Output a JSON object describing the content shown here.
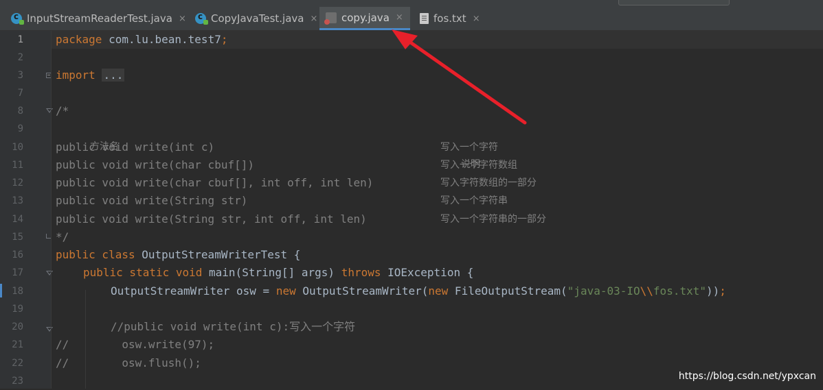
{
  "tabs": [
    {
      "label": "InputStreamReaderTest.java",
      "icon": "java-class-icon",
      "active": false
    },
    {
      "label": "CopyJavaTest.java",
      "icon": "java-class-icon",
      "active": false
    },
    {
      "label": "copy.java",
      "icon": "java-file-icon",
      "active": true
    },
    {
      "label": "fos.txt",
      "icon": "text-file-icon",
      "active": false
    }
  ],
  "close_glyph": "×",
  "line_numbers": [
    "1",
    "2",
    "3",
    "7",
    "8",
    "9",
    "10",
    "11",
    "12",
    "13",
    "14",
    "15",
    "16",
    "17",
    "18",
    "19",
    "20",
    "21",
    "22",
    "23"
  ],
  "code": {
    "l1_kw": "package",
    "l1_rest": " com.lu.bean.test7",
    "l1_semi": ";",
    "l3_kw": "import",
    "l3_fold": "...",
    "l8": "/*",
    "l9_a": "方法名",
    "l9_b": "说明",
    "m1_sig": "public void write(int c)",
    "m1_desc": "写入一个字符",
    "m2_sig": "public void write(char cbuf[])",
    "m2_desc": "写入一个字符数组",
    "m3_sig": "public void write(char cbuf[], int off, int len)",
    "m3_desc": "写入字符数组的一部分",
    "m4_sig": "public void write(String str)",
    "m4_desc": "写入一个字符串",
    "m5_sig": "public void write(String str, int off, int len)",
    "m5_desc": "写入一个字符串的一部分",
    "l15": "*/",
    "l16_kw": "public class",
    "l16_rest": " OutputStreamWriterTest {",
    "l17_kw1": "public static void",
    "l17_mid": " main(String[] args) ",
    "l17_kw2": "throws",
    "l17_rest": " IOException {",
    "l18_a": "OutputStreamWriter osw = ",
    "l18_new1": "new",
    "l18_b": " OutputStreamWriter(",
    "l18_new2": "new",
    "l18_c": " FileOutputStream(",
    "l18_str1": "\"java-03-IO",
    "l18_esc": "\\\\",
    "l18_str2": "fos.txt\"",
    "l18_d": "))",
    "l18_semi": ";",
    "l20": "//public void write(int c):写入一个字符",
    "l21": "//        osw.write(97);",
    "l22": "//        osw.flush();"
  },
  "watermark": "https://blog.csdn.net/ypxcan",
  "colors": {
    "keyword": "#cc7832",
    "string": "#6a8759",
    "comment": "#808080",
    "text": "#a9b7c6",
    "annotation_arrow": "#e8202a",
    "active_tab_underline": "#4a88c7"
  }
}
